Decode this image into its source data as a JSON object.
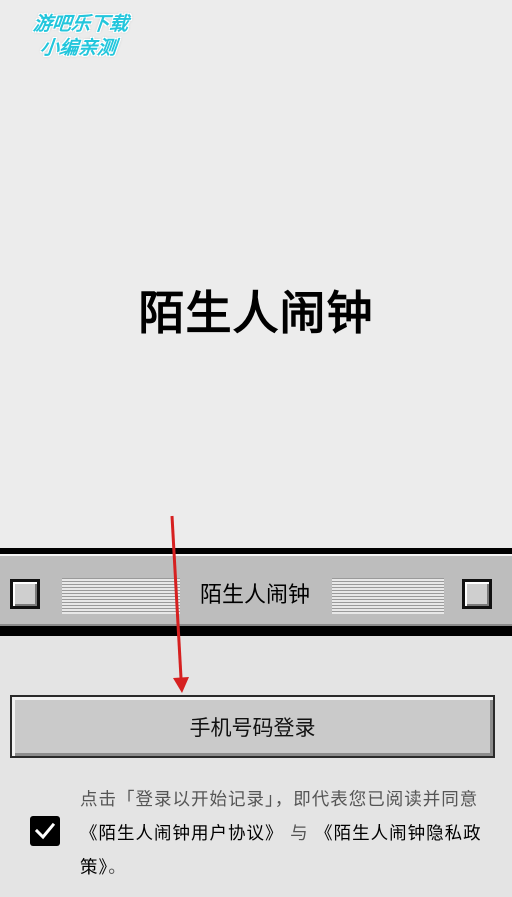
{
  "watermark": {
    "line1": "游吧乐下载",
    "line2": "小编亲测"
  },
  "app": {
    "title": "陌生人闹钟"
  },
  "window_bar": {
    "title": "陌生人闹钟"
  },
  "login": {
    "button_label": "手机号码登录"
  },
  "agreement": {
    "checked": true,
    "prefix": "点击「登录以开始记录」，即代表您已阅读并同意",
    "user_agreement": "《陌生人闹钟用户协议》",
    "connector": " 与 ",
    "privacy_policy": "《陌生人闹钟隐私政策》",
    "suffix": "。"
  },
  "colors": {
    "watermark": "#23c6dc",
    "arrow": "#d62020"
  },
  "icons": {
    "checkbox": "check-icon"
  }
}
